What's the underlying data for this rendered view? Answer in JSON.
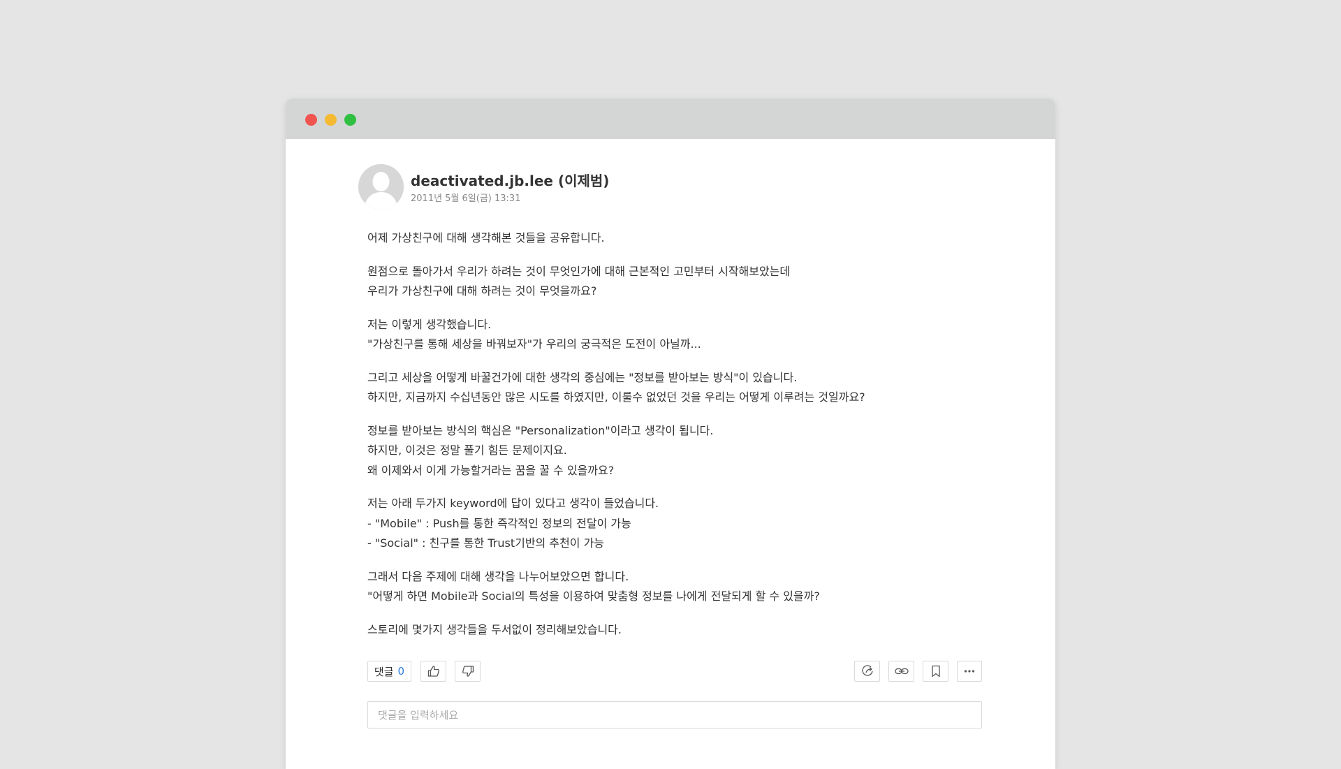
{
  "post": {
    "author": "deactivated.jb.lee (이제범)",
    "date": "2011년 5월 6일(금) 13:31",
    "paragraphs": [
      [
        "어제 가상친구에 대해 생각해본 것들을 공유합니다."
      ],
      [
        "원점으로 돌아가서 우리가 하려는 것이 무엇인가에 대해 근본적인 고민부터 시작해보았는데",
        "우리가 가상친구에 대해 하려는 것이 무엇을까요?"
      ],
      [
        "저는 이렇게 생각했습니다.",
        "\"가상친구를 통해 세상을 바꿔보자\"가 우리의 궁극적은 도전이 아닐까..."
      ],
      [
        "그리고 세상을 어떻게 바꿀건가에 대한 생각의 중심에는 \"정보를 받아보는 방식\"이 있습니다.",
        "하지만, 지금까지 수십년동안 많은 시도를 하였지만, 이룰수 없었던 것을 우리는 어떻게 이루려는 것일까요?"
      ],
      [
        "정보를 받아보는 방식의 핵심은 \"Personalization\"이라고 생각이 됩니다.",
        "하지만, 이것은 정말 풀기 힘든 문제이지요.",
        "왜 이제와서 이게 가능할거라는 꿈을 꿀 수 있을까요?"
      ],
      [
        "저는 아래 두가지 keyword에 답이 있다고 생각이 들었습니다.",
        "- \"Mobile\" : Push를 통한 즉각적인 정보의 전달이 가능",
        "- \"Social\" : 친구를 통한 Trust기반의 추천이 가능"
      ],
      [
        "그래서 다음 주제에 대해 생각을 나누어보았으면 합니다.",
        "\"어떻게 하면 Mobile과 Social의 특성을 이용하여 맞춤형 정보를 나에게 전달되게 할 수 있을까?"
      ],
      [
        "스토리에 몇가지 생각들을 두서없이 정리해보았습니다."
      ]
    ]
  },
  "actions": {
    "comment_label": "댓글",
    "comment_count": "0",
    "like_icon": "thumbs-up-icon",
    "dislike_icon": "thumbs-down-icon",
    "share_icon": "share-icon",
    "link_icon": "link-icon",
    "bookmark_icon": "bookmark-icon",
    "more_icon": "more-dots-icon"
  },
  "comment_box": {
    "placeholder": "댓글을 입력하세요"
  },
  "colors": {
    "comment_count": "#2b7be0",
    "traffic_close": "#f0544f",
    "traffic_min": "#f5b932",
    "traffic_max": "#2fc041"
  }
}
